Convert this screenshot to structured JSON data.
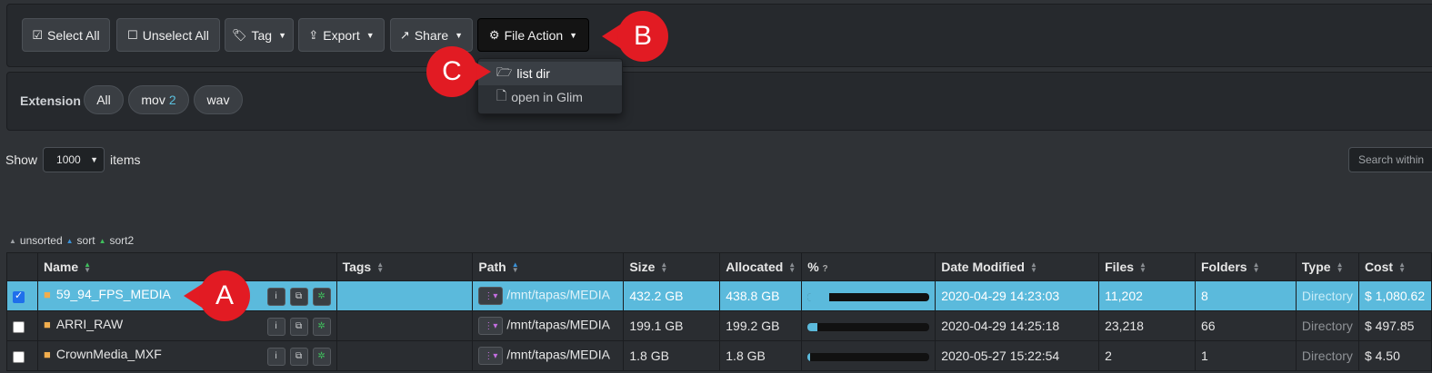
{
  "toolbar": {
    "select_all": "Select All",
    "unselect_all": "Unselect All",
    "tag": "Tag",
    "export": "Export",
    "share": "Share",
    "file_action": "File Action"
  },
  "file_action_menu": {
    "items": [
      {
        "label": "list dir",
        "icon": "folder-open-icon"
      },
      {
        "label": "open in Glim",
        "icon": "file-icon"
      }
    ]
  },
  "extension_filter": {
    "label": "Extension",
    "pills": [
      {
        "label": "All",
        "count": ""
      },
      {
        "label": "mov",
        "count": "2"
      },
      {
        "label": "wav",
        "count": ""
      }
    ]
  },
  "show": {
    "prefix": "Show",
    "value": "1000",
    "suffix": "items"
  },
  "search": {
    "placeholder": "Search within"
  },
  "sort_legend": {
    "unsorted": "unsorted",
    "sort": "sort",
    "sort2": "sort2"
  },
  "callouts": {
    "a": "A",
    "b": "B",
    "c": "C"
  },
  "table": {
    "headers": [
      "Name",
      "Tags",
      "Path",
      "Size",
      "Allocated",
      "%",
      "Date Modified",
      "Files",
      "Folders",
      "Type",
      "Cost"
    ],
    "rows": [
      {
        "selected": true,
        "name": "59_94_FPS_MEDIA",
        "tags": "",
        "path": "/mnt/tapas/MEDIA",
        "size": "432.2 GB",
        "allocated": "438.8 GB",
        "percent": 0.18,
        "date": "2020-04-29 14:23:03",
        "files": "11,202",
        "folders": "8",
        "type": "Directory",
        "cost": "$ 1,080.62"
      },
      {
        "selected": false,
        "name": "ARRI_RAW",
        "tags": "",
        "path": "/mnt/tapas/MEDIA",
        "size": "199.1 GB",
        "allocated": "199.2 GB",
        "percent": 0.08,
        "date": "2020-04-29 14:25:18",
        "files": "23,218",
        "folders": "66",
        "type": "Directory",
        "cost": "$ 497.85"
      },
      {
        "selected": false,
        "name": "CrownMedia_MXF",
        "tags": "",
        "path": "/mnt/tapas/MEDIA",
        "size": "1.8 GB",
        "allocated": "1.8 GB",
        "percent": 0.01,
        "date": "2020-05-27 15:22:54",
        "files": "2",
        "folders": "1",
        "type": "Directory",
        "cost": "$ 4.50"
      }
    ]
  },
  "colors": {
    "accent": "#5bbadc",
    "callout": "#e21b23",
    "folder": "#f0ad4e"
  }
}
